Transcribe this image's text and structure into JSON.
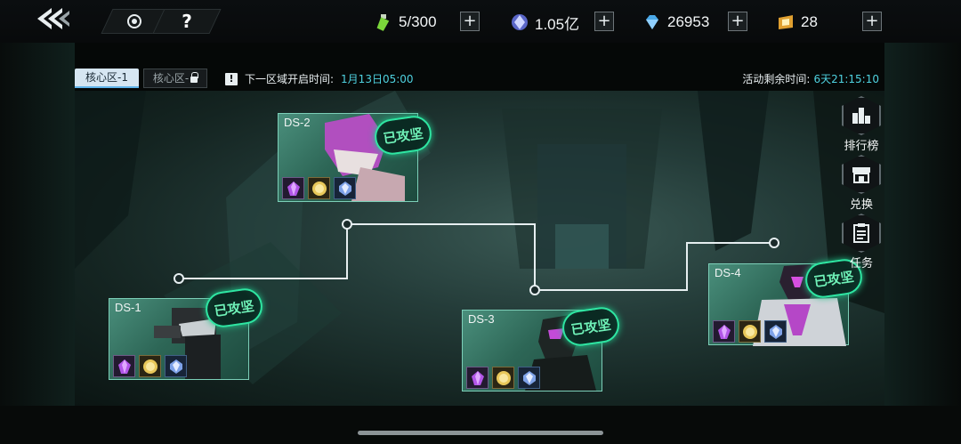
{
  "topbar": {
    "stamina": "5/300",
    "coins": "1.05亿",
    "gems": "26953",
    "tickets": "28",
    "plus_label": "+",
    "help_label": "?"
  },
  "tabs": [
    {
      "label": "核心区-1"
    },
    {
      "label": "核心区-"
    }
  ],
  "notice": {
    "icon": "!",
    "label": "下一区域开启时间:",
    "time": "1月13日05:00"
  },
  "remaining": {
    "label": "活动剩余时间:",
    "time": "6天21:15:10"
  },
  "stages": [
    {
      "id": "DS-1",
      "status": "已攻坚"
    },
    {
      "id": "DS-2",
      "status": "已攻坚"
    },
    {
      "id": "DS-3",
      "status": "已攻坚"
    },
    {
      "id": "DS-4",
      "status": "已攻坚"
    }
  ],
  "side_menu": {
    "ranking": "排行榜",
    "exchange": "兑换",
    "tasks": "任务"
  },
  "colors": {
    "accent_cyan": "#4fd2e0",
    "stamp_green": "#2ee6a2",
    "tab_active": "#d6e6f2"
  }
}
